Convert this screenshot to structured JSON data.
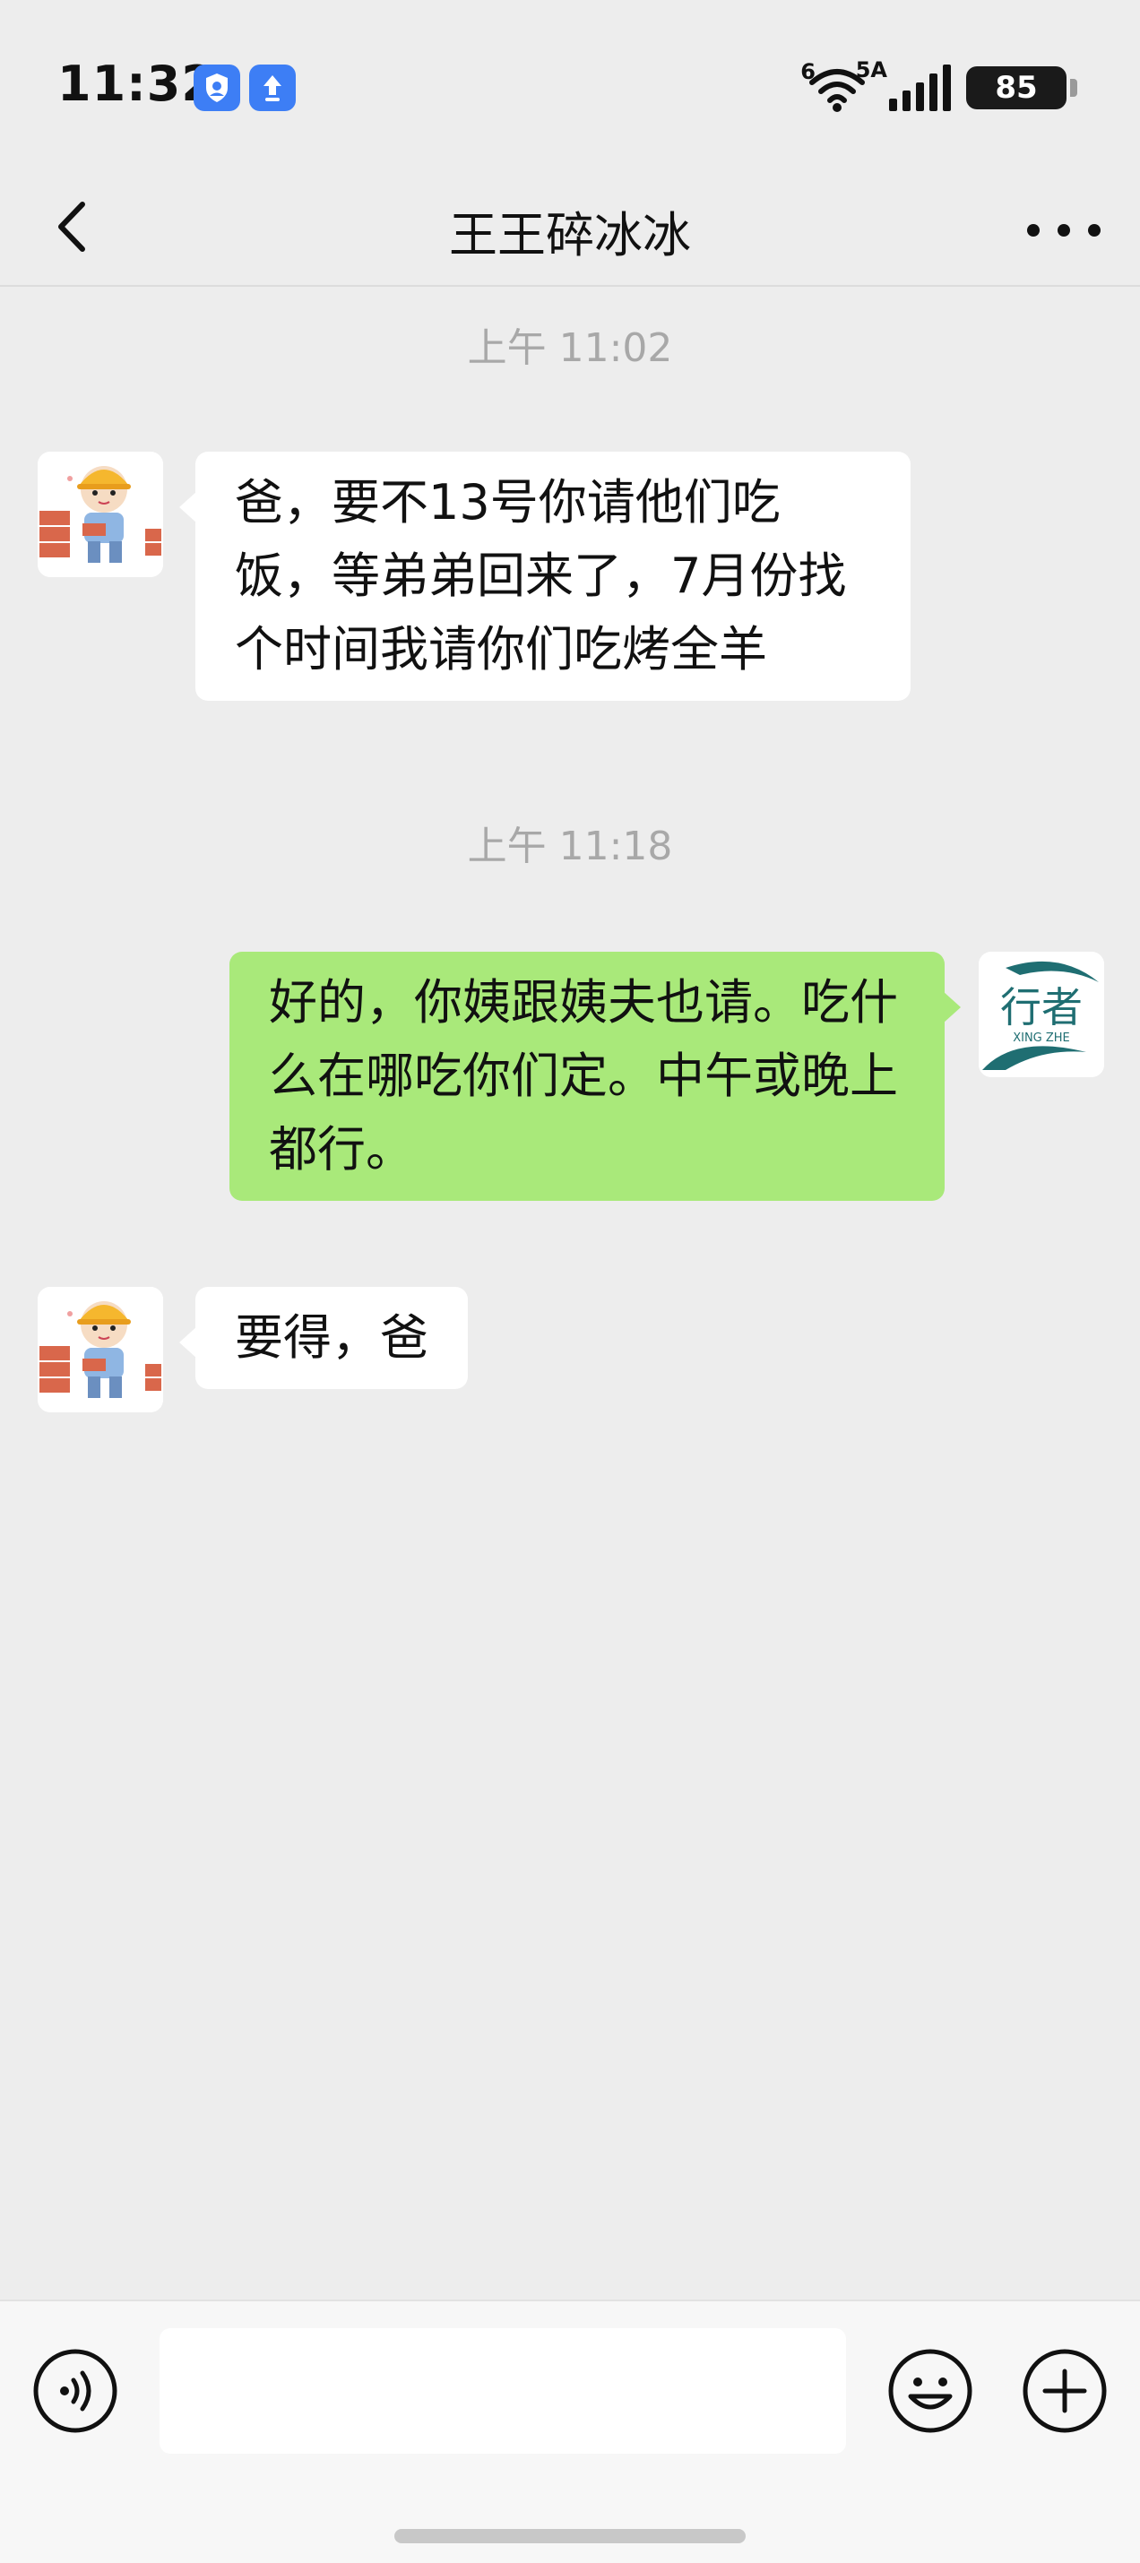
{
  "status_bar": {
    "time": "11:32",
    "network_label": "5A",
    "wifi_label": "6",
    "battery": "85",
    "icons": [
      "profile-shield-icon",
      "upload-icon",
      "wifi-icon",
      "signal-icon",
      "battery-icon"
    ]
  },
  "header": {
    "title": "王王碎冰冰",
    "back_icon": "chevron-left-icon",
    "more_icon": "more-dots-icon"
  },
  "messages": [
    {
      "type": "timestamp",
      "text": "上午 11:02"
    },
    {
      "type": "message",
      "side": "left",
      "text": "爸，要不13号你请他们吃饭，等弟弟回来了，7月份找个时间我请你们吃烤全羊"
    },
    {
      "type": "timestamp",
      "text": "上午 11:18"
    },
    {
      "type": "message",
      "side": "right",
      "text": "好的，你姨跟姨夫也请。吃什么在哪吃你们定。中午或晚上都行。",
      "avatar_brand_text": "行者",
      "avatar_brand_sub": "XING ZHE"
    },
    {
      "type": "message",
      "side": "left",
      "text": "要得，爸"
    }
  ],
  "input_bar": {
    "placeholder": "",
    "value": "",
    "icons": [
      "voice-icon",
      "emoji-icon",
      "plus-icon"
    ]
  },
  "colors": {
    "background": "#ededed",
    "bubble_self": "#a9e97a",
    "bubble_other": "#ffffff",
    "timestamp": "#a8a8a8",
    "brand_teal": "#1f6e72",
    "status_icon_blue": "#3d7ef5"
  }
}
